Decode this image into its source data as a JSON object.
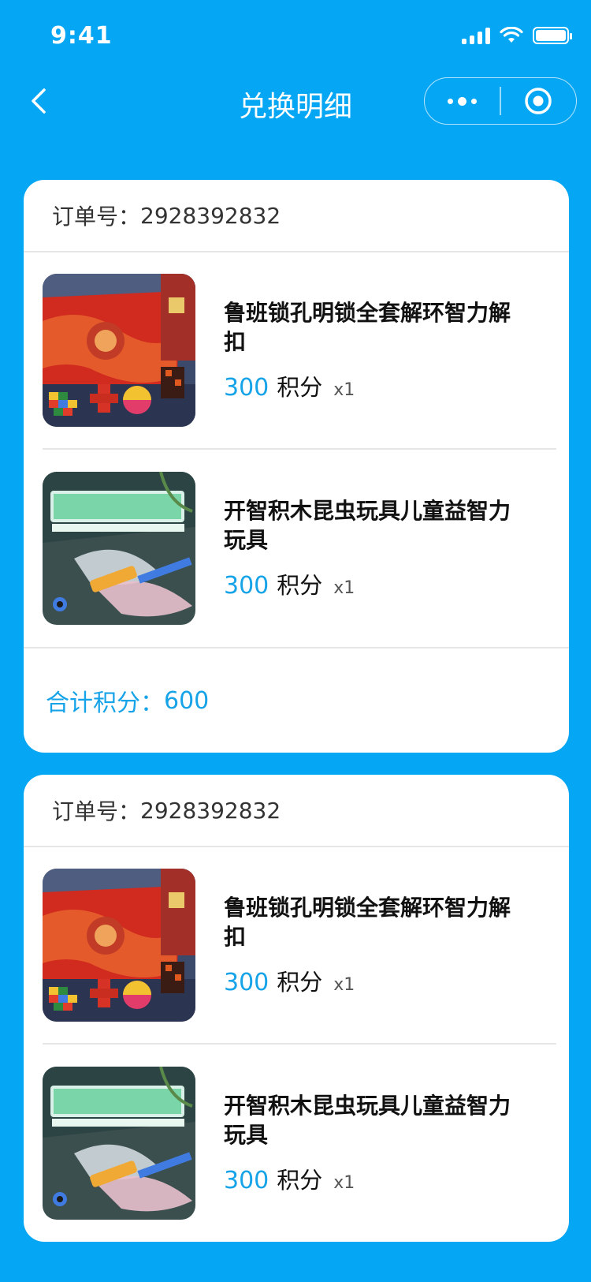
{
  "status_bar": {
    "time": "9:41"
  },
  "nav": {
    "title": "兑换明细"
  },
  "orders": [
    {
      "order_label": "订单号：",
      "order_number": "2928392832",
      "items": [
        {
          "title": "鲁班锁孔明锁全套解环智力解扣",
          "points": "300",
          "unit": "积分",
          "qty": "x1",
          "image_icon": "luban-lock-product-image"
        },
        {
          "title": "开智积木昆虫玩具儿童益智力玩具",
          "points": "300",
          "unit": "积分",
          "qty": "x1",
          "image_icon": "insect-blocks-product-image"
        }
      ],
      "total_label": "合计积分：",
      "total_value": "600"
    },
    {
      "order_label": "订单号：",
      "order_number": "2928392832",
      "items": [
        {
          "title": "鲁班锁孔明锁全套解环智力解扣",
          "points": "300",
          "unit": "积分",
          "qty": "x1",
          "image_icon": "luban-lock-product-image"
        },
        {
          "title": "开智积木昆虫玩具儿童益智力玩具",
          "points": "300",
          "unit": "积分",
          "qty": "x1",
          "image_icon": "insect-blocks-product-image"
        }
      ]
    }
  ],
  "colors": {
    "background": "#05a6f3",
    "accent": "#16a3e8"
  }
}
